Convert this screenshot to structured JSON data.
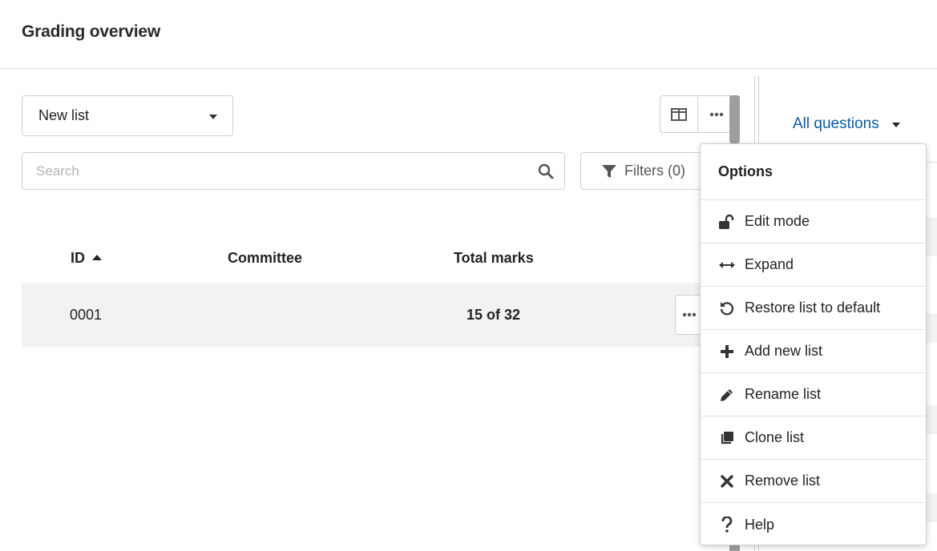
{
  "header": {
    "title": "Grading overview"
  },
  "toolbar": {
    "list_select": "New list",
    "search_placeholder": "Search",
    "filters_label": "Filters (0)"
  },
  "table": {
    "columns": [
      "ID",
      "Committee",
      "Total marks"
    ],
    "rows": [
      {
        "id": "0001",
        "committee": "",
        "total_marks": "15 of 32"
      }
    ]
  },
  "right_panel": {
    "questions_select": "All questions"
  },
  "options_menu": {
    "title": "Options",
    "items": [
      {
        "label": "Edit mode",
        "icon": "unlock-icon"
      },
      {
        "label": "Expand",
        "icon": "expand-arrows-icon"
      },
      {
        "label": "Restore list to default",
        "icon": "restore-icon"
      },
      {
        "label": "Add new list",
        "icon": "plus-icon"
      },
      {
        "label": "Rename list",
        "icon": "pencil-icon"
      },
      {
        "label": "Clone list",
        "icon": "clone-icon"
      },
      {
        "label": "Remove list",
        "icon": "close-icon"
      },
      {
        "label": "Help",
        "icon": "help-icon"
      }
    ]
  },
  "colors": {
    "link": "#0a5aa8",
    "row_bg": "#f2f2f2",
    "border": "#cfcfcf"
  }
}
